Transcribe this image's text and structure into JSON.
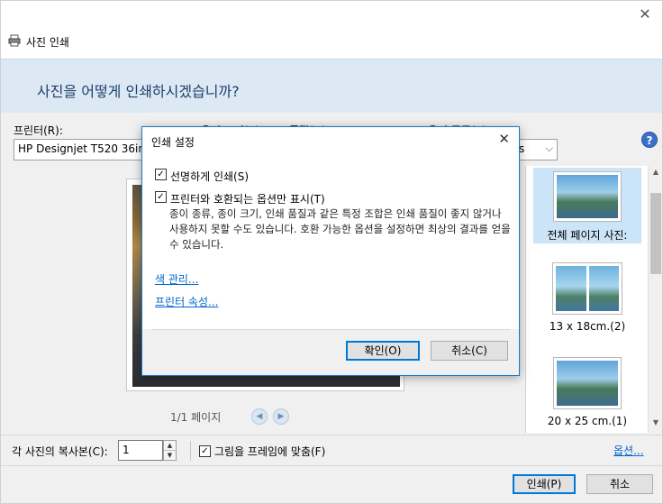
{
  "window": {
    "title": "사진 인쇄",
    "heading": "사진을 어떻게 인쇄하시겠습니까?"
  },
  "toolbar": {
    "printer_label": "프린터(R):",
    "paper_size_label": "용지 크기(S):",
    "quality_label": "품질(Q):",
    "paper_type_label": "용지 종류(T):",
    "printer_value": "HP Designjet T520 36in",
    "paper_type_value_tail": "s"
  },
  "preview": {
    "page_indicator": "1/1 페이지"
  },
  "layouts": {
    "items": [
      {
        "label": "전체 페이지 사진:"
      },
      {
        "label": "13 x 18cm.(2)"
      },
      {
        "label": "20 x 25 cm.(1)"
      }
    ]
  },
  "options": {
    "copies_label": "각 사진의 복사본(C):",
    "copies_value": "1",
    "fit_label": "그림을 프레임에 맞춤(F)",
    "options_link": "옵션..."
  },
  "footer": {
    "print_label": "인쇄(P)",
    "cancel_label": "취소"
  },
  "modal": {
    "title": "인쇄 설정",
    "sharpen_label": "선명하게 인쇄(S)",
    "compatible_label": "프린터와 호환되는 옵션만 표시(T)",
    "compatible_desc": "종이 종류, 종이 크기, 인쇄 품질과 같은 특정 조합은 인쇄 품질이 좋지 않거나 사용하지 못할 수도 있습니다. 호환 가능한 옵션을 설정하면 최상의 결과를 얻을 수 있습니다.",
    "color_link": "색 관리...",
    "printer_props_link": "프린터 속성...",
    "ok_label": "확인(O)",
    "cancel_label": "취소(C)"
  }
}
